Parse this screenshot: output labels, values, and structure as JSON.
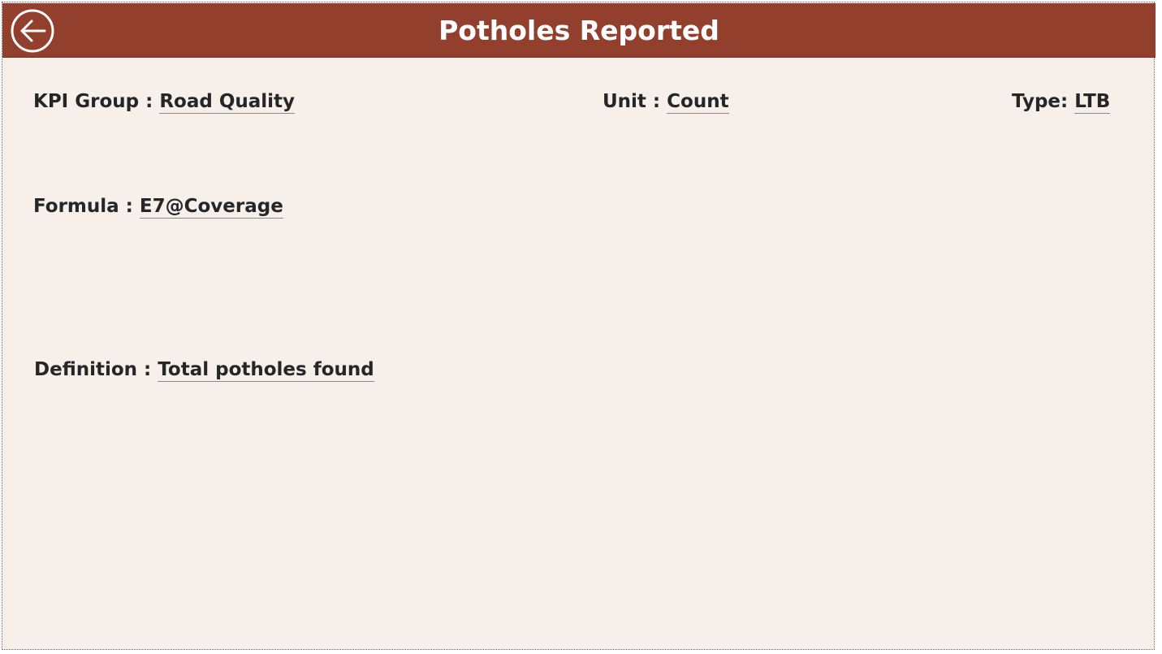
{
  "header": {
    "title": "Potholes Reported",
    "back_icon": "back-arrow-circle-icon"
  },
  "fields": {
    "kpi_group": {
      "label": "KPI Group : ",
      "value": "Road Quality"
    },
    "unit": {
      "label": "Unit : ",
      "value": "Count"
    },
    "type": {
      "label": "Type: ",
      "value": "LTB"
    },
    "formula": {
      "label": "Formula : ",
      "value": "E7@Coverage"
    },
    "definition": {
      "label": "Definition : ",
      "value": "Total potholes found"
    }
  },
  "colors": {
    "header_bg": "#92402d",
    "page_bg": "#f6efea",
    "text": "#262626"
  }
}
